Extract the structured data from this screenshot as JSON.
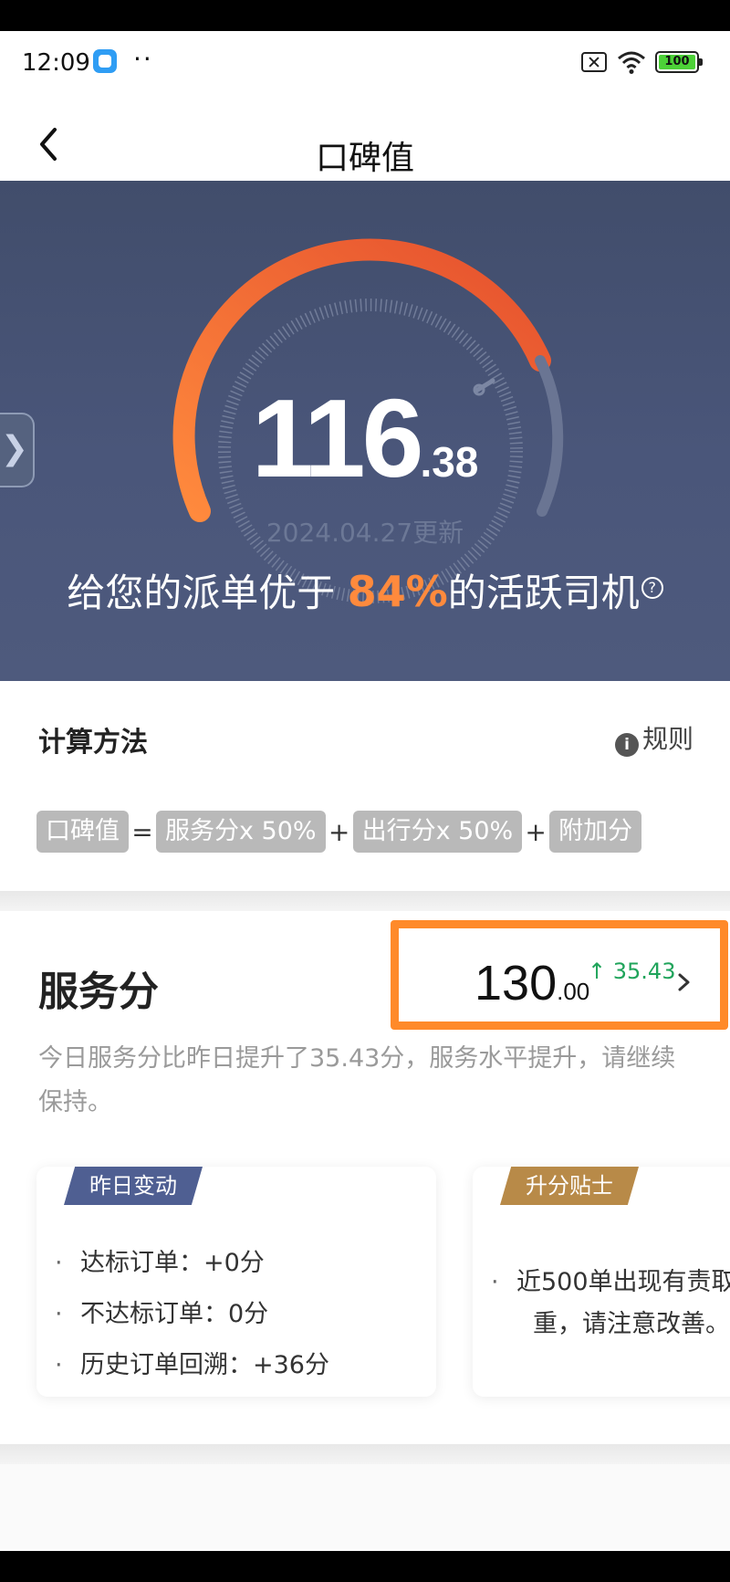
{
  "status_bar": {
    "time": "12:09",
    "dots": "··",
    "battery": "100"
  },
  "header": {
    "title": "口碑值"
  },
  "hero": {
    "score_integer": "116",
    "score_decimal": ".38",
    "updated": "2024.04.27更新",
    "rank_prefix": "给您的派单优于",
    "rank_percent": "84%",
    "rank_suffix": "的活跃司机",
    "help_glyph": "?",
    "side_tab_glyph": "❯"
  },
  "calc": {
    "title": "计算方法",
    "rules_label": "规则",
    "info_glyph": "i",
    "formula": {
      "result": "口碑值",
      "equals": "=",
      "term1": "服务分x 50%",
      "plus1": "+",
      "term2": "出行分x 50%",
      "plus2": "+",
      "term3": "附加分"
    }
  },
  "service": {
    "title": "服务分",
    "score_integer": "130",
    "score_decimal": ".00",
    "delta": "35.43",
    "delta_arrow": "↑",
    "description": "今日服务分比昨日提升了35.43分，服务水平提升，请继续保持。",
    "yesterday": {
      "tag": "昨日变动",
      "items": [
        "达标订单：+0分",
        "不达标订单：0分",
        "历史订单回溯：+36分"
      ]
    },
    "tips": {
      "tag": "升分贴士",
      "item_line1": "近500单出现有责取",
      "item_line2": "重，请注意改善。"
    }
  },
  "colors": {
    "hero_bg": "#464f6f",
    "accent_orange": "#ff8a3d",
    "delta_green": "#20a45b",
    "chip_gray": "#b9b9b9"
  }
}
